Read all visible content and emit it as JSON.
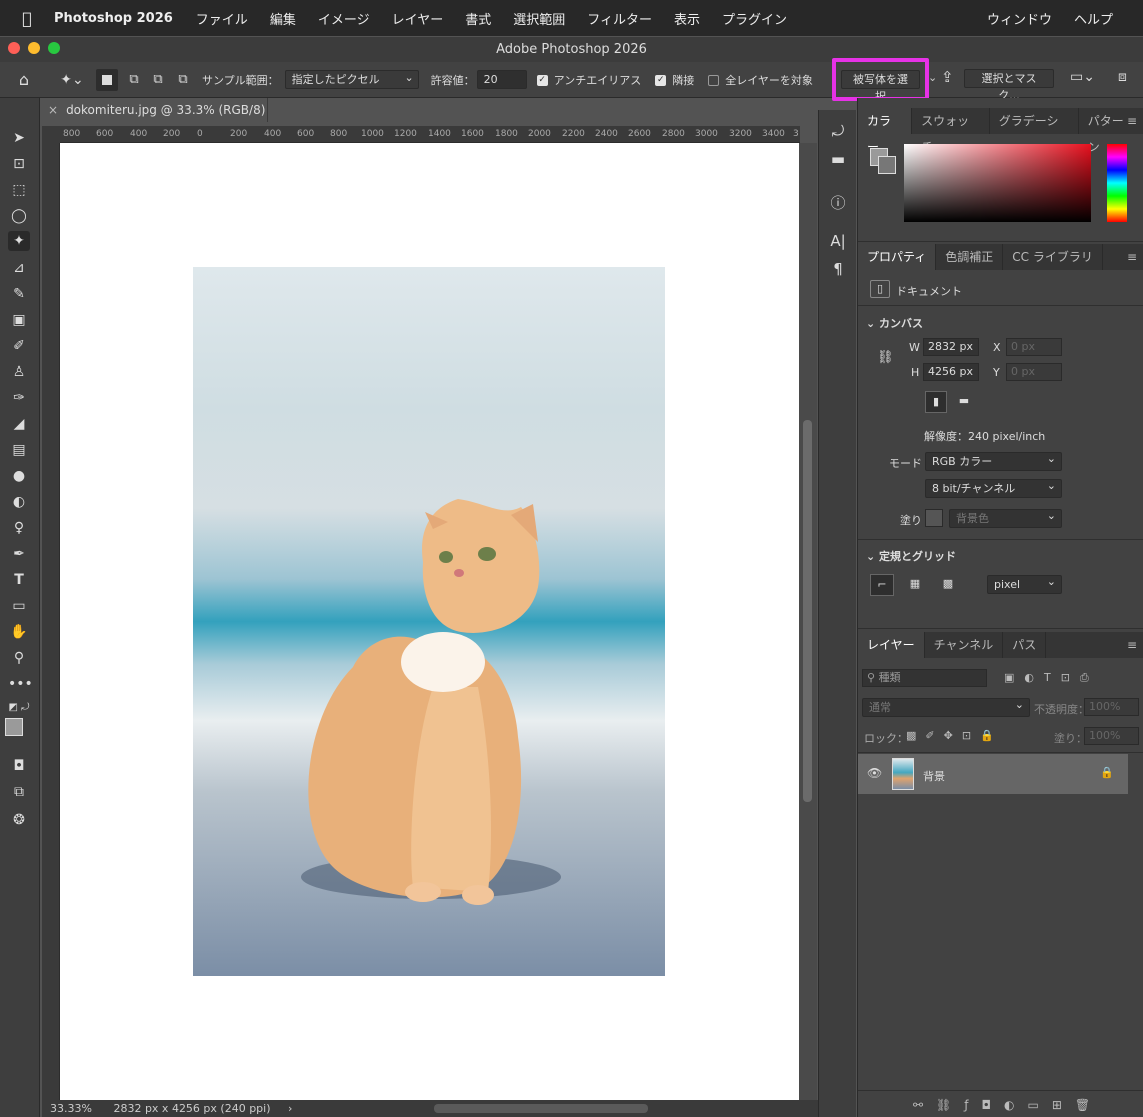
{
  "menubar": {
    "app_name": "Photoshop 2026",
    "items": [
      "ファイル",
      "編集",
      "イメージ",
      "レイヤー",
      "書式",
      "選択範囲",
      "フィルター",
      "表示",
      "プラグイン"
    ],
    "right_items": [
      "ウィンドウ",
      "ヘルプ"
    ]
  },
  "window": {
    "title": "Adobe Photoshop 2026"
  },
  "options": {
    "sample_label": "サンプル範囲：",
    "sample_value": "指定したピクセル",
    "tolerance_label": "許容値：",
    "tolerance_value": "20",
    "antialias_label": "アンチエイリアス",
    "contiguous_label": "隣接",
    "all_layers_label": "全レイヤーを対象",
    "select_subject": "被写体を選択",
    "select_mask": "選択とマスク..."
  },
  "document": {
    "tab_title": "dokomiteru.jpg @ 33.3% (RGB/8)",
    "zoom": "33.33%",
    "dims": "2832 px x 4256 px (240 ppi)"
  },
  "rulers": {
    "top": [
      "800",
      "600",
      "400",
      "200",
      "0",
      "200",
      "400",
      "600",
      "800",
      "1000",
      "1200",
      "1400",
      "1600",
      "1800",
      "2000",
      "2200",
      "2400",
      "2600",
      "2800",
      "3000",
      "3200",
      "3400",
      "3"
    ]
  },
  "color_panel": {
    "tabs": [
      "カラー",
      "スウォッチ",
      "グラデーショ",
      "パターン"
    ]
  },
  "properties_panel": {
    "tabs": [
      "プロパティ",
      "色調補正",
      "CC ライブラリ"
    ],
    "doc_label": "ドキュメント",
    "canvas_head": "カンバス",
    "w_label": "W",
    "w_value": "2832 px",
    "h_label": "H",
    "h_value": "4256 px",
    "x_label": "X",
    "x_value": "0 px",
    "y_label": "Y",
    "y_value": "0 px",
    "resolution": "解像度：240 pixel/inch",
    "mode_label": "モード",
    "mode_value": "RGB カラー",
    "bit_value": "8 bit/チャンネル",
    "fill_label": "塗り",
    "fill_value": "背景色",
    "rulers_head": "定規とグリッド",
    "unit_value": "pixel"
  },
  "layers_panel": {
    "tabs": [
      "レイヤー",
      "チャンネル",
      "パス"
    ],
    "kind_placeholder": "種類",
    "blend_mode": "通常",
    "opacity_label": "不透明度：",
    "opacity_value": "100%",
    "lock_label": "ロック：",
    "fill_label": "塗り：",
    "fill_value": "100%",
    "layer_name": "背景"
  },
  "colors": {
    "accent_highlight": "#e632e6",
    "panel_bg": "#424242"
  }
}
